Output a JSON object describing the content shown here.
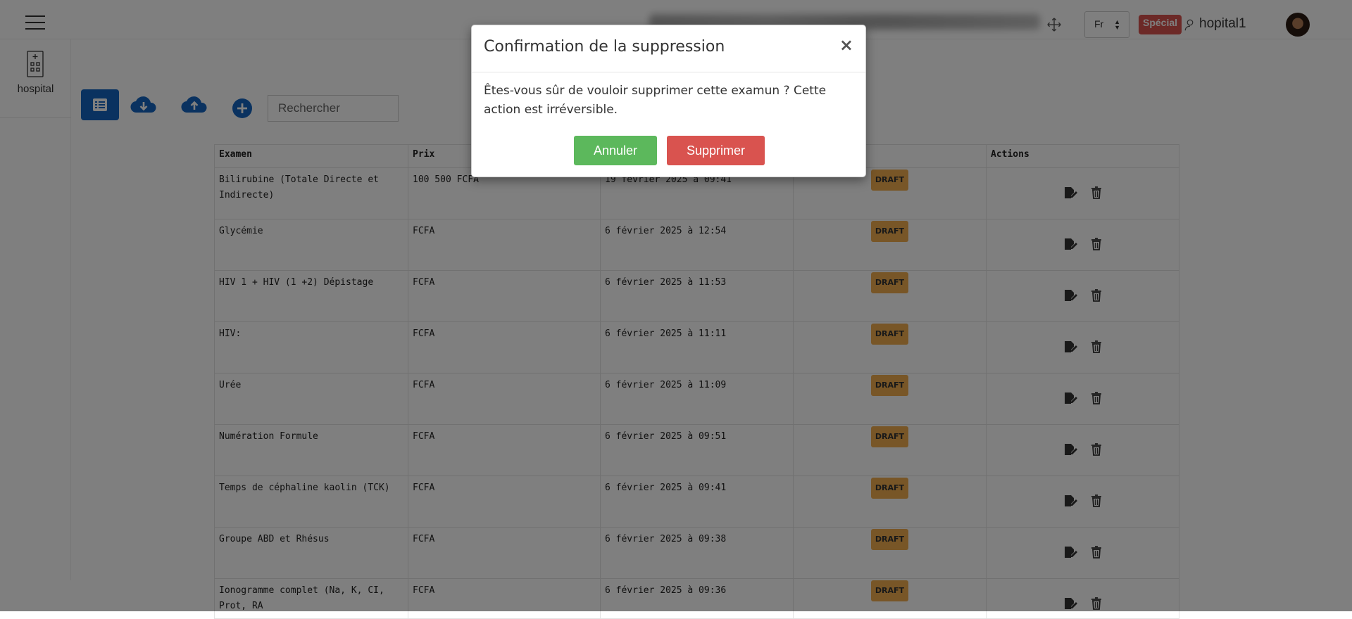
{
  "header": {
    "lang": "Fr",
    "special_badge": "Spécial",
    "username": "hopital1"
  },
  "sidebar": {
    "items": [
      {
        "label": "hospital",
        "icon": "hospital-building-icon"
      }
    ]
  },
  "toolbar": {
    "search_placeholder": "Rechercher",
    "icons": [
      "list-icon",
      "cloud-download-icon",
      "cloud-upload-icon",
      "add-circle-icon"
    ]
  },
  "table": {
    "headers": [
      "Examen",
      "Prix",
      "",
      "",
      "Actions"
    ],
    "rows": [
      {
        "examen": "Bilirubine (Totale Directe et Indirecte)",
        "prix": "100 500 FCFA",
        "date": "19 février 2025 à 09:41",
        "status": "DRAFT"
      },
      {
        "examen": "Glycémie",
        "prix": "FCFA",
        "date": "6 février 2025 à 12:54",
        "status": "DRAFT"
      },
      {
        "examen": "HIV 1 + HIV (1 +2) Dépistage",
        "prix": "FCFA",
        "date": "6 février 2025 à 11:53",
        "status": "DRAFT"
      },
      {
        "examen": "HIV:",
        "prix": "FCFA",
        "date": "6 février 2025 à 11:11",
        "status": "DRAFT"
      },
      {
        "examen": "Urée",
        "prix": "FCFA",
        "date": "6 février 2025 à 11:09",
        "status": "DRAFT"
      },
      {
        "examen": "Numération Formule",
        "prix": "FCFA",
        "date": "6 février 2025 à 09:51",
        "status": "DRAFT"
      },
      {
        "examen": "Temps de céphaline kaolin (TCK)",
        "prix": "FCFA",
        "date": "6 février 2025 à 09:41",
        "status": "DRAFT"
      },
      {
        "examen": "Groupe ABD et Rhésus",
        "prix": "FCFA",
        "date": "6 février 2025 à 09:38",
        "status": "DRAFT"
      },
      {
        "examen": "Ionogramme complet (Na, K, CI, Prot, RA",
        "prix": "FCFA",
        "date": "6 février 2025 à 09:36",
        "status": "DRAFT"
      }
    ]
  },
  "modal": {
    "title": "Confirmation de la suppression",
    "close": "×",
    "message": "Êtes-vous sûr de vouloir supprimer cette examun ? Cette action est irréversible.",
    "cancel_label": "Annuler",
    "delete_label": "Supprimer"
  },
  "colors": {
    "primary": "#1565c0",
    "success": "#5cb85c",
    "danger": "#d9534f",
    "warning": "#f0ad4e"
  }
}
